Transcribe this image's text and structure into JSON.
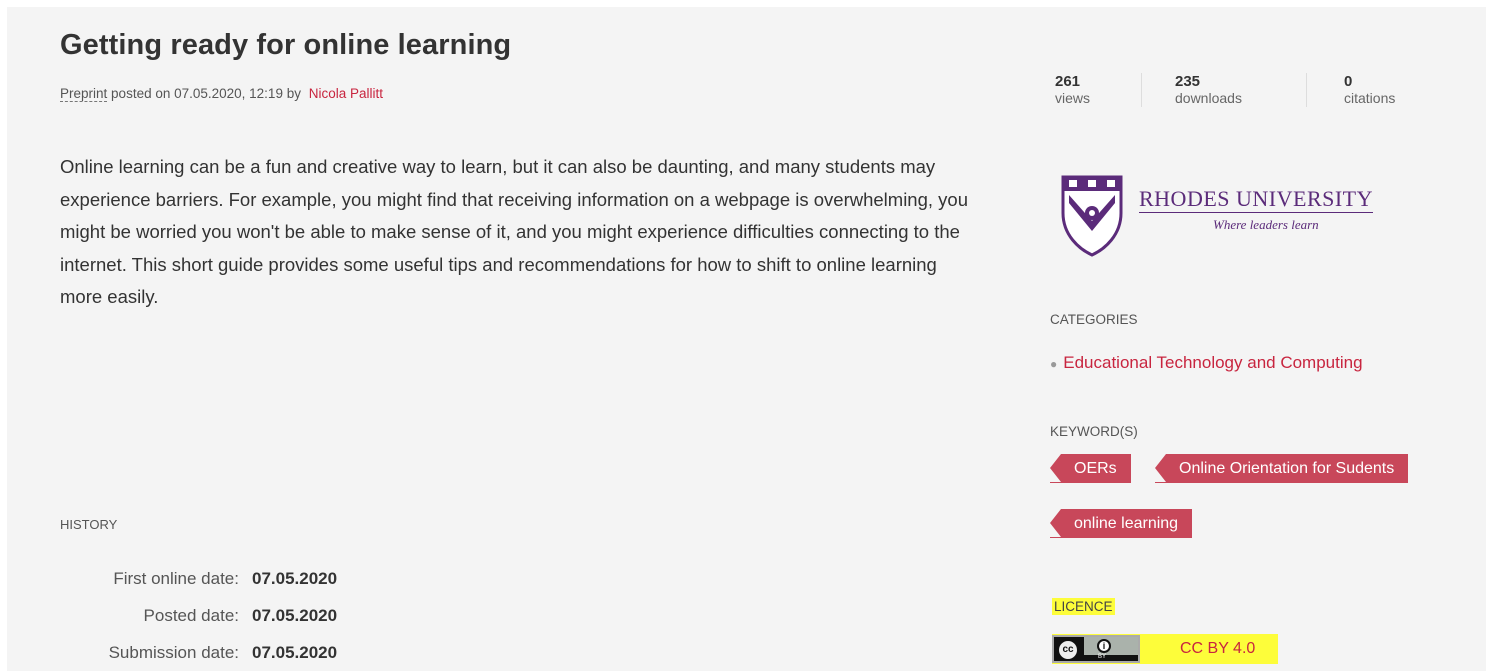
{
  "article": {
    "title": "Getting ready for online learning",
    "item_type": "Preprint",
    "posted_text": "posted on 07.05.2020, 12:19 by",
    "author": "Nicola Pallitt",
    "abstract": "Online learning can be a fun and creative way to learn, but it can also be daunting, and many students may experience barriers. For example, you might find that receiving information on a webpage is overwhelming, you might be worried you won't be able to make sense of it, and you might experience difficulties connecting to the internet. This short guide provides some useful tips and recommendations for how to shift to online learning more easily."
  },
  "history": {
    "label": "HISTORY",
    "rows": [
      {
        "label": "First online date:",
        "value": "07.05.2020"
      },
      {
        "label": "Posted date:",
        "value": "07.05.2020"
      },
      {
        "label": "Submission date:",
        "value": "07.05.2020"
      }
    ]
  },
  "stats": [
    {
      "value": "261",
      "label": "views"
    },
    {
      "value": "235",
      "label": "downloads"
    },
    {
      "value": "0",
      "label": "citations"
    }
  ],
  "institution": {
    "name": "RHODES UNIVERSITY",
    "tagline": "Where leaders learn",
    "brand_color": "#5b2b7a"
  },
  "categories": {
    "label": "CATEGORIES",
    "items": [
      "Educational Technology and Computing"
    ]
  },
  "keywords": {
    "label": "KEYWORD(S)",
    "items": [
      "OERs",
      "Online Orientation for Sudents",
      "online learning"
    ]
  },
  "licence": {
    "label": "LICENCE",
    "link_text": "CC BY 4.0",
    "badge_cc": "cc",
    "badge_by": "BY"
  },
  "colors": {
    "accent": "#c8253f",
    "tag_bg": "#c8475a",
    "highlight": "#fdfd3a",
    "page_bg": "#f4f4f4"
  }
}
